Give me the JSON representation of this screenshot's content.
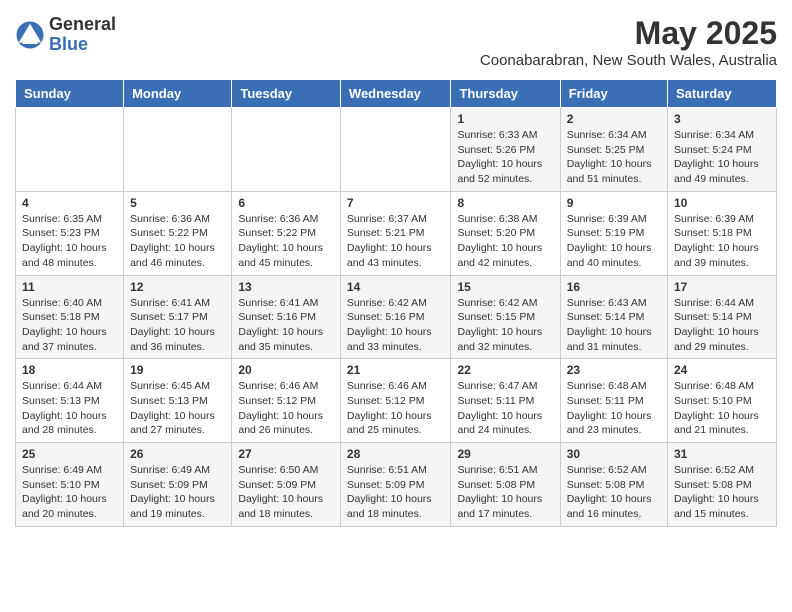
{
  "header": {
    "logo_general": "General",
    "logo_blue": "Blue",
    "month_year": "May 2025",
    "location": "Coonabarabran, New South Wales, Australia"
  },
  "weekdays": [
    "Sunday",
    "Monday",
    "Tuesday",
    "Wednesday",
    "Thursday",
    "Friday",
    "Saturday"
  ],
  "rows": [
    [
      {
        "day": "",
        "info": ""
      },
      {
        "day": "",
        "info": ""
      },
      {
        "day": "",
        "info": ""
      },
      {
        "day": "",
        "info": ""
      },
      {
        "day": "1",
        "info": "Sunrise: 6:33 AM\nSunset: 5:26 PM\nDaylight: 10 hours\nand 52 minutes."
      },
      {
        "day": "2",
        "info": "Sunrise: 6:34 AM\nSunset: 5:25 PM\nDaylight: 10 hours\nand 51 minutes."
      },
      {
        "day": "3",
        "info": "Sunrise: 6:34 AM\nSunset: 5:24 PM\nDaylight: 10 hours\nand 49 minutes."
      }
    ],
    [
      {
        "day": "4",
        "info": "Sunrise: 6:35 AM\nSunset: 5:23 PM\nDaylight: 10 hours\nand 48 minutes."
      },
      {
        "day": "5",
        "info": "Sunrise: 6:36 AM\nSunset: 5:22 PM\nDaylight: 10 hours\nand 46 minutes."
      },
      {
        "day": "6",
        "info": "Sunrise: 6:36 AM\nSunset: 5:22 PM\nDaylight: 10 hours\nand 45 minutes."
      },
      {
        "day": "7",
        "info": "Sunrise: 6:37 AM\nSunset: 5:21 PM\nDaylight: 10 hours\nand 43 minutes."
      },
      {
        "day": "8",
        "info": "Sunrise: 6:38 AM\nSunset: 5:20 PM\nDaylight: 10 hours\nand 42 minutes."
      },
      {
        "day": "9",
        "info": "Sunrise: 6:39 AM\nSunset: 5:19 PM\nDaylight: 10 hours\nand 40 minutes."
      },
      {
        "day": "10",
        "info": "Sunrise: 6:39 AM\nSunset: 5:18 PM\nDaylight: 10 hours\nand 39 minutes."
      }
    ],
    [
      {
        "day": "11",
        "info": "Sunrise: 6:40 AM\nSunset: 5:18 PM\nDaylight: 10 hours\nand 37 minutes."
      },
      {
        "day": "12",
        "info": "Sunrise: 6:41 AM\nSunset: 5:17 PM\nDaylight: 10 hours\nand 36 minutes."
      },
      {
        "day": "13",
        "info": "Sunrise: 6:41 AM\nSunset: 5:16 PM\nDaylight: 10 hours\nand 35 minutes."
      },
      {
        "day": "14",
        "info": "Sunrise: 6:42 AM\nSunset: 5:16 PM\nDaylight: 10 hours\nand 33 minutes."
      },
      {
        "day": "15",
        "info": "Sunrise: 6:42 AM\nSunset: 5:15 PM\nDaylight: 10 hours\nand 32 minutes."
      },
      {
        "day": "16",
        "info": "Sunrise: 6:43 AM\nSunset: 5:14 PM\nDaylight: 10 hours\nand 31 minutes."
      },
      {
        "day": "17",
        "info": "Sunrise: 6:44 AM\nSunset: 5:14 PM\nDaylight: 10 hours\nand 29 minutes."
      }
    ],
    [
      {
        "day": "18",
        "info": "Sunrise: 6:44 AM\nSunset: 5:13 PM\nDaylight: 10 hours\nand 28 minutes."
      },
      {
        "day": "19",
        "info": "Sunrise: 6:45 AM\nSunset: 5:13 PM\nDaylight: 10 hours\nand 27 minutes."
      },
      {
        "day": "20",
        "info": "Sunrise: 6:46 AM\nSunset: 5:12 PM\nDaylight: 10 hours\nand 26 minutes."
      },
      {
        "day": "21",
        "info": "Sunrise: 6:46 AM\nSunset: 5:12 PM\nDaylight: 10 hours\nand 25 minutes."
      },
      {
        "day": "22",
        "info": "Sunrise: 6:47 AM\nSunset: 5:11 PM\nDaylight: 10 hours\nand 24 minutes."
      },
      {
        "day": "23",
        "info": "Sunrise: 6:48 AM\nSunset: 5:11 PM\nDaylight: 10 hours\nand 23 minutes."
      },
      {
        "day": "24",
        "info": "Sunrise: 6:48 AM\nSunset: 5:10 PM\nDaylight: 10 hours\nand 21 minutes."
      }
    ],
    [
      {
        "day": "25",
        "info": "Sunrise: 6:49 AM\nSunset: 5:10 PM\nDaylight: 10 hours\nand 20 minutes."
      },
      {
        "day": "26",
        "info": "Sunrise: 6:49 AM\nSunset: 5:09 PM\nDaylight: 10 hours\nand 19 minutes."
      },
      {
        "day": "27",
        "info": "Sunrise: 6:50 AM\nSunset: 5:09 PM\nDaylight: 10 hours\nand 18 minutes."
      },
      {
        "day": "28",
        "info": "Sunrise: 6:51 AM\nSunset: 5:09 PM\nDaylight: 10 hours\nand 18 minutes."
      },
      {
        "day": "29",
        "info": "Sunrise: 6:51 AM\nSunset: 5:08 PM\nDaylight: 10 hours\nand 17 minutes."
      },
      {
        "day": "30",
        "info": "Sunrise: 6:52 AM\nSunset: 5:08 PM\nDaylight: 10 hours\nand 16 minutes."
      },
      {
        "day": "31",
        "info": "Sunrise: 6:52 AM\nSunset: 5:08 PM\nDaylight: 10 hours\nand 15 minutes."
      }
    ]
  ]
}
